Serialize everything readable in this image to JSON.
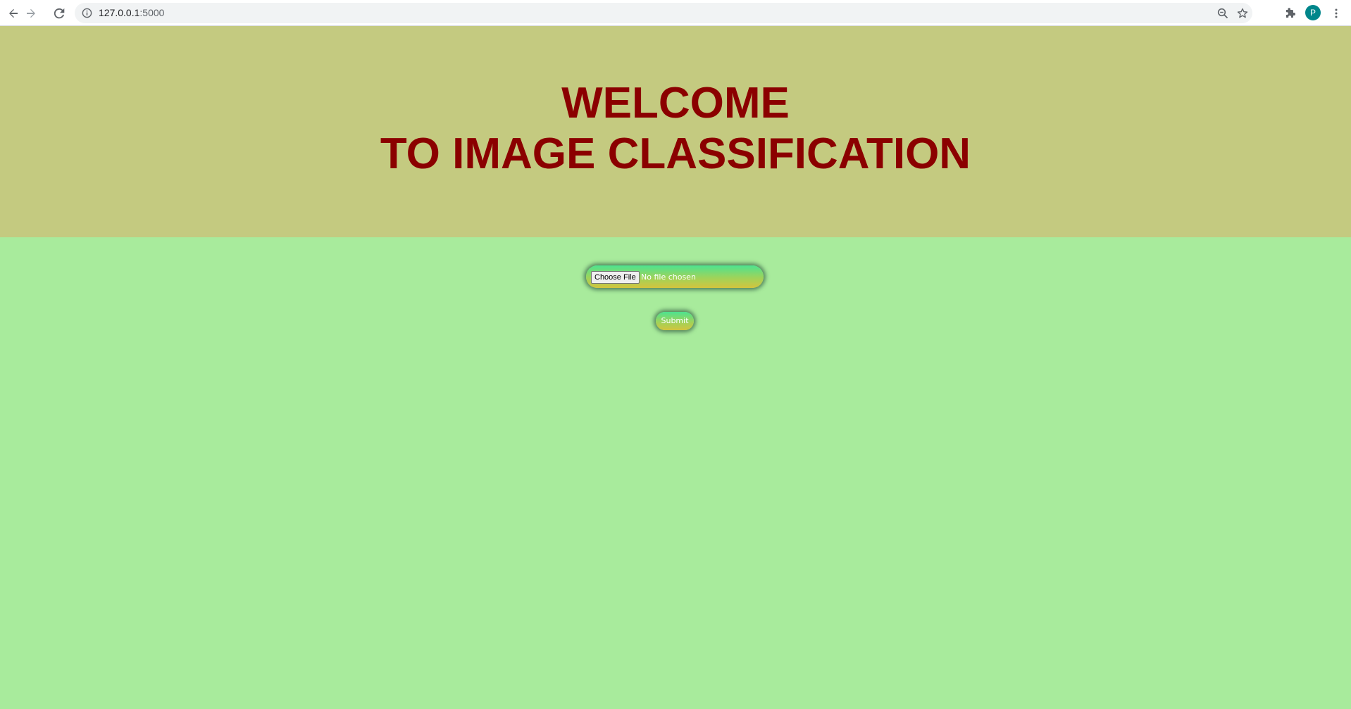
{
  "browser": {
    "url_host": "127.0.0.1",
    "url_port": ":5000",
    "profile_initial": "P",
    "icons": {
      "back": "back-arrow-icon",
      "forward": "forward-arrow-icon",
      "reload": "reload-icon",
      "site_info": "info-icon",
      "zoom": "zoom-icon",
      "bookmark": "star-icon",
      "extensions": "puzzle-icon",
      "menu": "more-vert-icon"
    },
    "colors": {
      "avatar": "#00868b"
    }
  },
  "page": {
    "header": {
      "line1": "WELCOME",
      "line2": "TO IMAGE CLASSIFICATION"
    },
    "upload_form": {
      "choose_file_label": "Choose File",
      "file_status": "No file chosen",
      "submit_label": "Submit"
    },
    "colors": {
      "header_background": "#c4ca80",
      "heading_text": "#8b0000",
      "body_background": "#a8eb9c",
      "pill_gradient_top": "#4de38f",
      "pill_gradient_bottom": "#d3c43d"
    }
  }
}
